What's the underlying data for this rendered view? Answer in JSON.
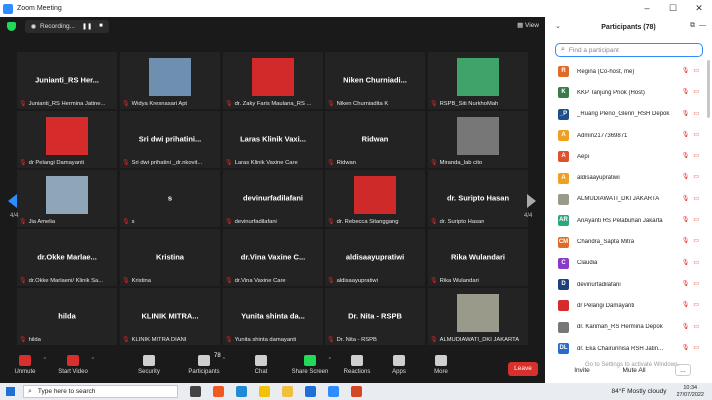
{
  "window": {
    "title": "Zoom Meeting",
    "controls": [
      "–",
      "☐",
      "✕"
    ]
  },
  "meeting": {
    "recording_label": "Recording...",
    "pause_glyph": "❚❚",
    "stop_glyph": "■",
    "view_label": "View",
    "page_left": "4/4",
    "page_right": "4/4",
    "tiles": [
      {
        "name": "Junianti_RS  Her...",
        "label": "Junianti_RS Hermina Jatine..."
      },
      {
        "name": "",
        "label": "Widya Kresnasari Apt",
        "video": true,
        "video_color": "#6f8fb0"
      },
      {
        "name": "",
        "label": "dr. Zaky Faris Maulana_RS ...",
        "video": true,
        "video_color": "#d22a2a"
      },
      {
        "name": "Niken  Churniadi...",
        "label": "Niken Churniadita K"
      },
      {
        "name": "",
        "label": "RSPB_Siti NurkhoMah",
        "video": true,
        "video_color": "#3fa36a"
      },
      {
        "name": "",
        "label": "dr Pelangi Damayanti",
        "video": true,
        "video_color": "#d62b2b"
      },
      {
        "name": "Sri  dwi  prihatini...",
        "label": "Sri dwi prihatini _dr.nkovit..."
      },
      {
        "name": "Laras Klinik Vaxi...",
        "label": "Laras Klinik Vaxine Care"
      },
      {
        "name": "Ridwan",
        "label": "Ridwan"
      },
      {
        "name": "",
        "label": "Miranda_lab cito",
        "video": true,
        "video_color": "#777777"
      },
      {
        "name": "",
        "label": "Jia Amelia",
        "video": true,
        "video_color": "#8fa6b8"
      },
      {
        "name": "s",
        "label": "s"
      },
      {
        "name": "devinurfadilafani",
        "label": "devinurfadilafani"
      },
      {
        "name": "",
        "label": "dr. Rebecca Sitanggang",
        "video": true,
        "video_color": "#cf2a2a"
      },
      {
        "name": "dr. Suripto  Hasan",
        "label": "dr. Suripto Hasan"
      },
      {
        "name": "dr.Okke  Marlae...",
        "label": "dr.Okke Marlaeni/ Klinik Sa..."
      },
      {
        "name": "Kristina",
        "label": "Kristina"
      },
      {
        "name": "dr.Vina  Vaxine  C...",
        "label": "dr.Vina Vaxine Care"
      },
      {
        "name": "aldisaayupratiwi",
        "label": "aldisaayupratiwi"
      },
      {
        "name": "Rika  Wulandari",
        "label": "Rika Wulandari"
      },
      {
        "name": "hilda",
        "label": "hilda"
      },
      {
        "name": "KLINIK  MITRA...",
        "label": "KLINIK MITRA DIANI"
      },
      {
        "name": "Yunita  shinta  da...",
        "label": "Yunita shinta damayanti"
      },
      {
        "name": "Dr.  Nita  -  RSPB",
        "label": "Dr. Nita - RSPB"
      },
      {
        "name": "",
        "label": "ALMUDIAWATI_DKI JAKARTA",
        "video": true,
        "video_color": "#9a9a8a"
      }
    ]
  },
  "toolbar": {
    "items": [
      {
        "label": "Unmute",
        "icon": "microphone-muted-icon",
        "color": "#d8302c"
      },
      {
        "label": "Start Video",
        "icon": "video-off-icon",
        "color": "#d8302c"
      },
      {
        "label": "Security",
        "icon": "shield-icon",
        "color": "#cfcfcf"
      },
      {
        "label": "Participants",
        "icon": "participants-icon",
        "color": "#cfcfcf"
      },
      {
        "label": "Chat",
        "icon": "chat-icon",
        "color": "#cfcfcf"
      },
      {
        "label": "Share Screen",
        "icon": "share-screen-icon",
        "color": "#23d959"
      },
      {
        "label": "Reactions",
        "icon": "reactions-icon",
        "color": "#cfcfcf"
      },
      {
        "label": "Apps",
        "icon": "apps-icon",
        "color": "#cfcfcf"
      },
      {
        "label": "More",
        "icon": "more-icon",
        "color": "#cfcfcf"
      }
    ],
    "participant_count": "78",
    "leave_label": "Leave"
  },
  "panel": {
    "title": "Participants (78)",
    "search_placeholder": "Find a participant",
    "participants": [
      {
        "name": "Regina (Co-host, me)",
        "initial": "R",
        "color": "#e06a2a"
      },
      {
        "name": "KKP Tanjung Priok (Host)",
        "initial": "K",
        "color": "#3a7a4a"
      },
      {
        "name": "_Ruang Pleno_Glenn_RSH Depok",
        "initial": "_P",
        "color": "#1f4f8a"
      },
      {
        "name": "Admin2177369871",
        "initial": "A",
        "color": "#f0a020"
      },
      {
        "name": "Aepi",
        "initial": "A",
        "color": "#e0502a"
      },
      {
        "name": "aldisaayupratiwi",
        "initial": "A",
        "color": "#f0a020"
      },
      {
        "name": "ALMUDIAWATI_DKI JAKARTA",
        "initial": "",
        "color": "#9a9a8a"
      },
      {
        "name": "AriAyanti RS Pelabuhan Jakarta",
        "initial": "AR",
        "color": "#2aa87a"
      },
      {
        "name": "Chandra_Sapta Mitra",
        "initial": "CM",
        "color": "#e06a2a"
      },
      {
        "name": "Claudia",
        "initial": "C",
        "color": "#8a3ac8"
      },
      {
        "name": "devinurfadilafani",
        "initial": "D",
        "color": "#1f3f7a"
      },
      {
        "name": "dr Pelangi Damayanti",
        "initial": "",
        "color": "#d62b2b"
      },
      {
        "name": "dr. Karimah_RS Hermina Depok",
        "initial": "",
        "color": "#777777"
      },
      {
        "name": "dr. Eka Chairunnisa RSH Jatin...",
        "initial": "DL",
        "color": "#2a6ac8"
      }
    ],
    "footer": {
      "invite": "Invite",
      "mute_all": "Mute All",
      "more": "...",
      "watermark": "Go to Settings to activate Windows."
    }
  },
  "taskbar": {
    "search_placeholder": "Type here to search",
    "apps": [
      {
        "name": "task-view",
        "color": "#444"
      },
      {
        "name": "brave-browser",
        "color": "#f05a22"
      },
      {
        "name": "edge-browser",
        "color": "#1f8ad6"
      },
      {
        "name": "chrome-browser",
        "color": "#f2c20a"
      },
      {
        "name": "file-explorer",
        "color": "#f0c040"
      },
      {
        "name": "mail",
        "color": "#1f6fd6"
      },
      {
        "name": "zoom",
        "color": "#2d8cff"
      },
      {
        "name": "powerpoint",
        "color": "#d24726"
      }
    ],
    "weather": "84°F  Mostly cloudy",
    "time": "10:34",
    "date": "27/07/2022"
  }
}
